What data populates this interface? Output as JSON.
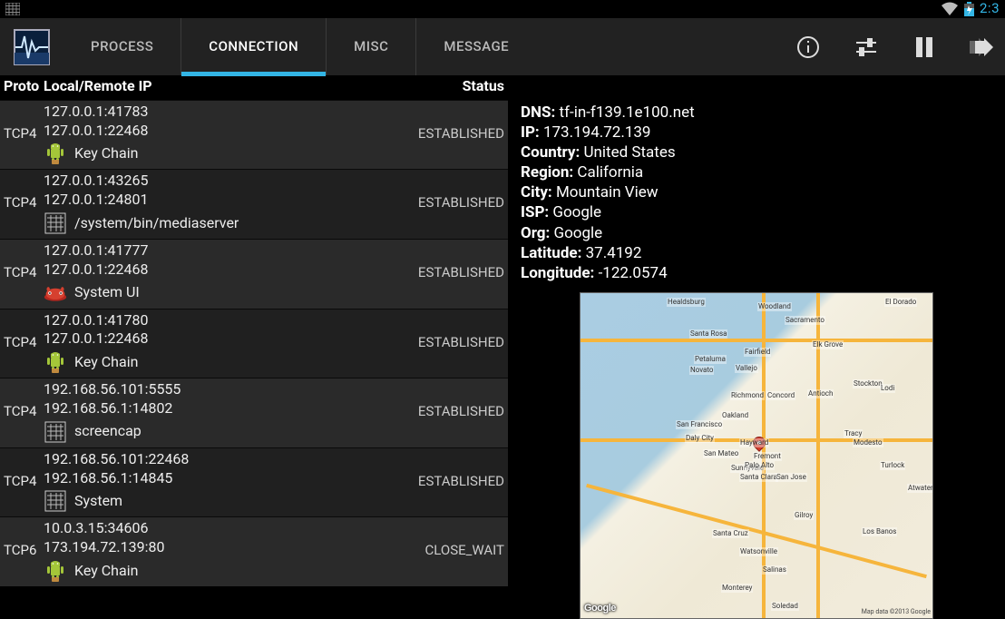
{
  "status_bar": {
    "clock": "2:3"
  },
  "app": {
    "tabs": [
      "PROCESS",
      "CONNECTION",
      "MISC",
      "MESSAGE"
    ],
    "active_tab": 1
  },
  "columns": {
    "proto": "Proto",
    "ip": "Local/Remote IP",
    "status": "Status"
  },
  "connections": [
    {
      "proto": "TCP4",
      "local": "127.0.0.1:41783",
      "remote": "127.0.0.1:22468",
      "process": "Key Chain",
      "icon": "android",
      "status": "ESTABLISHED"
    },
    {
      "proto": "TCP4",
      "local": "127.0.0.1:43265",
      "remote": "127.0.0.1:24801",
      "process": "/system/bin/mediaserver",
      "icon": "native",
      "status": "ESTABLISHED"
    },
    {
      "proto": "TCP4",
      "local": "127.0.0.1:41777",
      "remote": "127.0.0.1:22468",
      "process": "System UI",
      "icon": "systemui",
      "status": "ESTABLISHED"
    },
    {
      "proto": "TCP4",
      "local": "127.0.0.1:41780",
      "remote": "127.0.0.1:22468",
      "process": "Key Chain",
      "icon": "android",
      "status": "ESTABLISHED"
    },
    {
      "proto": "TCP4",
      "local": "192.168.56.101:5555",
      "remote": "192.168.56.1:14802",
      "process": "screencap",
      "icon": "native",
      "status": "ESTABLISHED"
    },
    {
      "proto": "TCP4",
      "local": "192.168.56.101:22468",
      "remote": "192.168.56.1:14845",
      "process": "System",
      "icon": "native",
      "status": "ESTABLISHED"
    },
    {
      "proto": "TCP6",
      "local": "10.0.3.15:34606",
      "remote": "173.194.72.139:80",
      "process": "Key Chain",
      "icon": "android",
      "status": "CLOSE_WAIT"
    }
  ],
  "detail": {
    "labels": {
      "dns": "DNS:",
      "ip": "IP:",
      "country": "Country:",
      "region": "Region:",
      "city": "City:",
      "isp": "ISP:",
      "org": "Org:",
      "lat": "Latitude:",
      "lng": "Longitude:"
    },
    "dns": "tf-in-f139.1e100.net",
    "ip": "173.194.72.139",
    "country": "United States",
    "region": "California",
    "city": "Mountain View",
    "isp": "Google",
    "org": "Google",
    "lat": "37.4192",
    "lng": "-122.0574"
  },
  "map": {
    "logo": "Google",
    "copyright": "Map data ©2013 Google",
    "cities": [
      "Healdsburg",
      "Woodland",
      "El Dorado",
      "Sacramento",
      "Santa Rosa",
      "Petaluma",
      "Fairfield",
      "Elk Grove",
      "Vallejo",
      "Novato",
      "Stockton",
      "Richmond",
      "Concord",
      "Antioch",
      "Lodi",
      "Oakland",
      "San Francisco",
      "Tracy",
      "Modesto",
      "Daly City",
      "Hayward",
      "Sunnyvale",
      "San Mateo",
      "Fremont",
      "Palo Alto",
      "Turlock",
      "Santa Clara",
      "San Jose",
      "Atwater",
      "Gilroy",
      "Los Banos",
      "Santa Cruz",
      "Watsonville",
      "Salinas",
      "Monterey",
      "Soledad"
    ]
  }
}
